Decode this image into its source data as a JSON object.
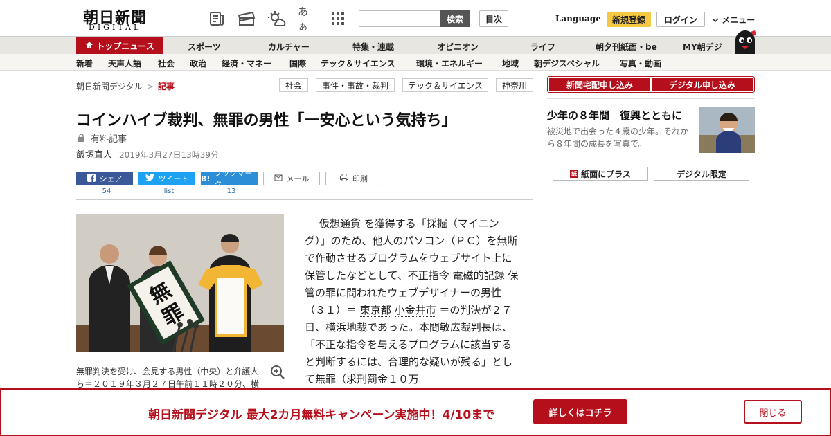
{
  "header": {
    "logo_jp": "朝日新聞",
    "logo_en": "DIGITAL",
    "search_button": "検索",
    "search_placeholder": "",
    "toc_button": "目次",
    "language": "Language",
    "signup": "新規登録",
    "login": "ログイン",
    "menu": "メニュー",
    "font_size_label": "あぁ"
  },
  "nav_primary": [
    "トップニュース",
    "スポーツ",
    "カルチャー",
    "特集・連載",
    "オピニオン",
    "ライフ",
    "朝夕刊紙面・be",
    "MY朝デジ"
  ],
  "nav_secondary": [
    "新着",
    "天声人語",
    "社会",
    "政治",
    "経済・マネー",
    "国際",
    "テック＆サイエンス",
    "環境・エネルギー",
    "地域",
    "朝デジスペシャル",
    "写真・動画"
  ],
  "breadcrumb": {
    "home": "朝日新聞デジタル",
    "separator": ">",
    "current": "記事"
  },
  "tags": [
    "社会",
    "事件・事故・裁判",
    "テック＆サイエンス",
    "神奈川"
  ],
  "article": {
    "title": "コインハイブ裁判、無罪の男性「一安心という気持ち」",
    "paid_label": "有料記事",
    "author": "飯塚直人",
    "date": "2019年3月27日13時39分",
    "photo_caption": "無罪判決を受け、会見する男性（中央）と弁護人ら＝２０１９年３月２７日午前１１時２０分、横",
    "photo_sign_text": "無罪",
    "body_segments": {
      "s1": "仮想通貨",
      "s2": " を獲得する「採掘（マイニング）」のため、他人のパソコン（ＰＣ）を無断で作動させるプログラムをウェブサイト上に保管したなどとして、不正指令 ",
      "s3": "電磁的記録",
      "s4": " 保管の罪に問われたウェブデザイナーの男性（３１）＝ ",
      "s5": "東京都",
      "s6": "  ",
      "s7": "小金井市",
      "s8": " ＝の判決が２７日、横浜地裁であった。本間敏広裁判長は、「不正な指令を与えるプログラムに該当すると判断するには、合理的な疑いが残る」として無罪（求刑罰金１０万"
    }
  },
  "share": {
    "facebook": "シェア",
    "facebook_count": "54",
    "twitter": "ツイート",
    "twitter_count": "list",
    "hatena": "ブックマーク",
    "hatena_icon": "B!",
    "hatena_count": "13",
    "mail": "メール",
    "print": "印刷"
  },
  "sidebar": {
    "sub_newspaper": "新聞宅配申し込み",
    "sub_digital": "デジタル申し込み",
    "promo_title": "少年の８年間　復興とともに",
    "promo_desc": "被災地で出会った４歳の少年。それから８年間の成長を写真で。",
    "btn_paper_plus": "紙面にプラス",
    "btn_paper_plus_icon": "紙",
    "btn_digital_only": "デジタル限定"
  },
  "banner": {
    "text": "朝日新聞デジタル 最大2カ月無料キャンペーン実施中！4/10まで",
    "cta": "詳しくはコチラ",
    "close": "閉じる"
  },
  "colors": {
    "brand_red": "#b50f1b",
    "accent_yellow": "#f5c842",
    "facebook": "#3b5998",
    "twitter": "#1da1f2",
    "hatena": "#2c8ed6"
  }
}
